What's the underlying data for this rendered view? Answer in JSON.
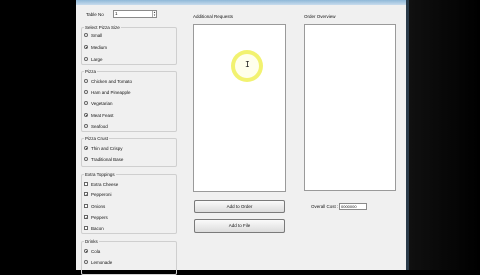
{
  "window": {
    "title": ""
  },
  "table_no": {
    "label": "Table No",
    "value": "1"
  },
  "pizza_size": {
    "caption": "Select Pizza Size",
    "options": [
      {
        "label": "Small",
        "selected": false
      },
      {
        "label": "Medium",
        "selected": true
      },
      {
        "label": "Large",
        "selected": false
      }
    ]
  },
  "pizza": {
    "caption": "Pizza",
    "options": [
      {
        "label": "Chicken and Tomato",
        "selected": false
      },
      {
        "label": "Ham and Pineapple",
        "selected": false
      },
      {
        "label": "Vegetarian",
        "selected": false
      },
      {
        "label": "Meat Feast",
        "selected": true
      },
      {
        "label": "Seafood",
        "selected": false
      }
    ]
  },
  "pizza_crust": {
    "caption": "Pizza Crust",
    "options": [
      {
        "label": "Thin and Crispy",
        "selected": true
      },
      {
        "label": "Traditional Base",
        "selected": false
      }
    ]
  },
  "extra_toppings": {
    "caption": "Extra Toppings",
    "options": [
      {
        "label": "Extra Cheese",
        "checked": false
      },
      {
        "label": "Pepperoni",
        "checked": true
      },
      {
        "label": "Onions",
        "checked": false
      },
      {
        "label": "Peppers",
        "checked": true
      },
      {
        "label": "Bacon",
        "checked": false
      }
    ]
  },
  "drinks": {
    "caption": "Drinks",
    "options": [
      {
        "label": "Cola",
        "selected": true
      },
      {
        "label": "Lemonade",
        "selected": false
      }
    ]
  },
  "additional_requests": {
    "label": "Additional Requests"
  },
  "order_overview": {
    "label": "Order Overview"
  },
  "buttons": {
    "add_to_order": "Add to Order",
    "add_to_file": "Add to File"
  },
  "overall_cost": {
    "label": "Overall Cost :",
    "value": "0000000"
  }
}
